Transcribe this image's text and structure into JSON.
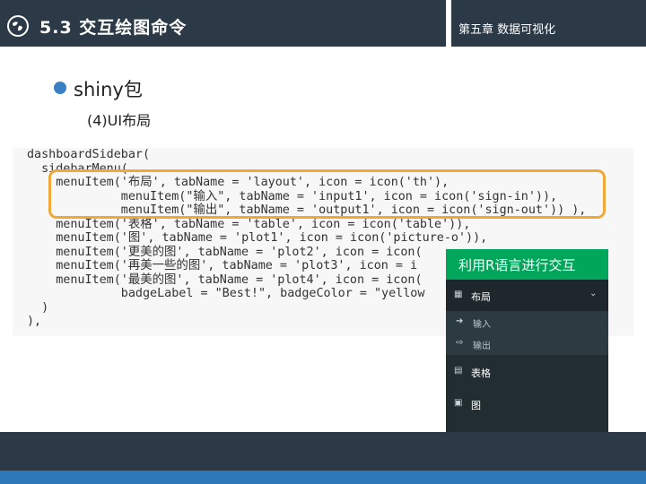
{
  "header": {
    "title": "5.3 交互绘图命令",
    "chapter": "第五章 数据可视化"
  },
  "bullet": {
    "text": "shiny包",
    "sub": "(4)UI布局"
  },
  "code": {
    "lines": [
      "dashboardSidebar(",
      "  sidebarMenu(",
      "    menuItem('布局', tabName = 'layout', icon = icon('th'),",
      "             menuItem(\"输入\", tabName = 'input1', icon = icon('sign-in')),",
      "             menuItem(\"输出\", tabName = 'output1', icon = icon('sign-out')) ),",
      "    menuItem('表格', tabName = 'table', icon = icon('table')),",
      "    menuItem('图', tabName = 'plot1', icon = icon('picture-o')),",
      "    menuItem('更美的图', tabName = 'plot2', icon = icon(",
      "    menuItem('再美一些的图', tabName = 'plot3', icon = i",
      "    menuItem('最美的图', tabName = 'plot4', icon = icon(",
      "             badgeLabel = \"Best!\", badgeColor = \"yellow",
      "  )",
      "),"
    ]
  },
  "shiny_app": {
    "title": "利用R语言进行交互",
    "menu": [
      {
        "label": "布局",
        "icon": "th-icon"
      },
      {
        "label": "输入",
        "icon": "sign-in-icon"
      },
      {
        "label": "输出",
        "icon": "sign-out-icon"
      },
      {
        "label": "表格",
        "icon": "table-icon"
      },
      {
        "label": "图",
        "icon": "picture-icon"
      }
    ]
  },
  "colors": {
    "header_bg": "#2b3a46",
    "accent_blue": "#2d76b8",
    "highlight": "#f0a838",
    "shiny_green": "#00a65a",
    "shiny_sidebar": "#222d32"
  }
}
